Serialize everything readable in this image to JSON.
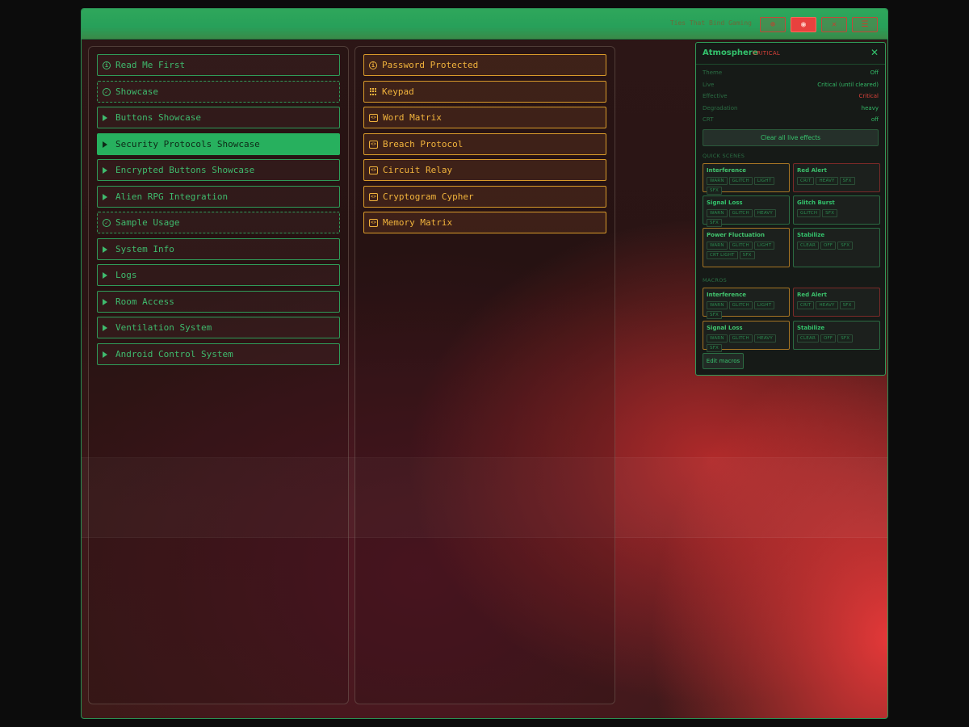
{
  "topbar": {
    "brand": "Ties That Bind Gaming",
    "buttons": [
      {
        "icon": "globe-icon",
        "glyph": "⊕"
      },
      {
        "icon": "atmosphere-icon",
        "glyph": "◉",
        "active": true
      },
      {
        "icon": "tools-icon",
        "glyph": "✕"
      },
      {
        "icon": "menu-icon",
        "glyph": "☰"
      }
    ]
  },
  "left_panel": {
    "items": [
      {
        "label": "Read Me First",
        "icon": "info-icon"
      },
      {
        "label": "Showcase",
        "icon": "check-icon"
      },
      {
        "label": "Buttons Showcase",
        "icon": "triangle-icon"
      },
      {
        "label": "Security Protocols Showcase",
        "icon": "triangle-icon"
      },
      {
        "label": "Encrypted Buttons Showcase",
        "icon": "triangle-icon"
      },
      {
        "label": "Alien RPG Integration",
        "icon": "triangle-icon"
      },
      {
        "label": "Sample Usage",
        "icon": "check-icon"
      },
      {
        "label": "System Info",
        "icon": "triangle-icon"
      },
      {
        "label": "Logs",
        "icon": "triangle-icon"
      },
      {
        "label": "Room Access",
        "icon": "triangle-icon"
      },
      {
        "label": "Ventilation System",
        "icon": "triangle-icon"
      },
      {
        "label": "Android Control System",
        "icon": "triangle-icon"
      }
    ]
  },
  "middle_panel": {
    "items": [
      {
        "label": "Password Protected",
        "icon": "info-icon"
      },
      {
        "label": "Keypad",
        "icon": "keypad-icon"
      },
      {
        "label": "Word Matrix",
        "icon": "code-icon"
      },
      {
        "label": "Breach Protocol",
        "icon": "code-icon"
      },
      {
        "label": "Circuit Relay",
        "icon": "code-icon"
      },
      {
        "label": "Cryptogram Cypher",
        "icon": "code-icon"
      },
      {
        "label": "Memory Matrix",
        "icon": "code-icon"
      }
    ]
  },
  "atmosphere": {
    "title": "Atmosphere",
    "status": "CRITICAL",
    "rows": [
      {
        "key": "Theme",
        "value": "Off"
      },
      {
        "key": "Live",
        "value": "Critical (until cleared)"
      },
      {
        "key": "Effective",
        "value": "Critical"
      },
      {
        "key": "Degradation",
        "value": "heavy"
      },
      {
        "key": "CRT",
        "value": "off"
      }
    ],
    "clear_label": "Clear all live effects",
    "quick_scenes_label": "QUICK SCENES",
    "quick_scenes": [
      {
        "name": "Interference",
        "tags": [
          "WARN",
          "GLITCH",
          "LIGHT",
          "SFX"
        ]
      },
      {
        "name": "Red Alert",
        "tags": [
          "CRIT",
          "HEAVY",
          "SFX"
        ]
      },
      {
        "name": "Signal Loss",
        "tags": [
          "WARN",
          "GLITCH",
          "HEAVY",
          "SFX"
        ]
      },
      {
        "name": "Glitch Burst",
        "tags": [
          "GLITCH",
          "SFX"
        ]
      },
      {
        "name": "Power Fluctuation",
        "tags": [
          "WARN",
          "GLITCH",
          "LIGHT",
          "CRT LIGHT",
          "SFX"
        ]
      },
      {
        "name": "Stabilize",
        "tags": [
          "CLEAR",
          "OFF",
          "SFX"
        ]
      }
    ],
    "macros_label": "MACROS",
    "macros": [
      {
        "name": "Interference",
        "tags": [
          "WARN",
          "GLITCH",
          "LIGHT",
          "SFX"
        ]
      },
      {
        "name": "Red Alert",
        "tags": [
          "CRIT",
          "HEAVY",
          "SFX"
        ]
      },
      {
        "name": "Signal Loss",
        "tags": [
          "WARN",
          "GLITCH",
          "HEAVY",
          "SFX"
        ]
      },
      {
        "name": "Stabilize",
        "tags": [
          "CLEAR",
          "OFF",
          "SFX"
        ]
      }
    ],
    "edit_label": "Edit macros"
  },
  "colors": {
    "accent_green": "#2fa75b",
    "active_item": "#27b05e",
    "orange": "#f1b33c",
    "critical_red": "#d8413a"
  }
}
